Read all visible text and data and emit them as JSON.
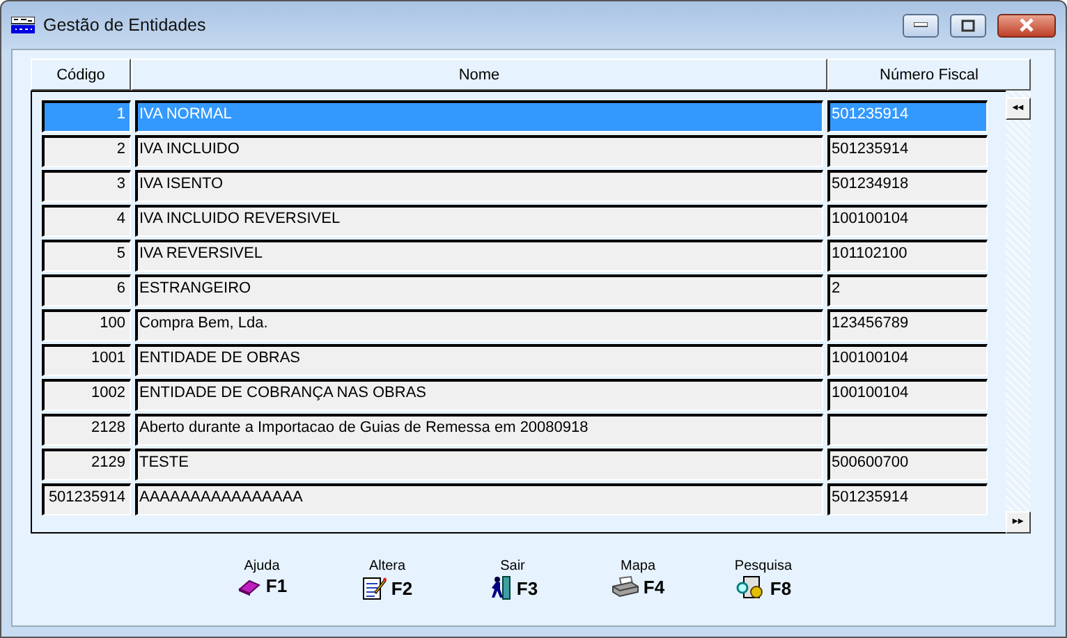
{
  "window": {
    "title": "Gestão de Entidades"
  },
  "table": {
    "columns": [
      "Código",
      "Nome",
      "Número Fiscal"
    ],
    "rows": [
      {
        "code": "1",
        "name": "IVA NORMAL",
        "fiscal": "501235914",
        "selected": true
      },
      {
        "code": "2",
        "name": "IVA INCLUIDO",
        "fiscal": "501235914",
        "selected": false
      },
      {
        "code": "3",
        "name": "IVA ISENTO",
        "fiscal": "501234918",
        "selected": false
      },
      {
        "code": "4",
        "name": "IVA INCLUIDO REVERSIVEL",
        "fiscal": "100100104",
        "selected": false
      },
      {
        "code": "5",
        "name": "IVA REVERSIVEL",
        "fiscal": "101102100",
        "selected": false
      },
      {
        "code": "6",
        "name": "ESTRANGEIRO",
        "fiscal": "2",
        "selected": false
      },
      {
        "code": "100",
        "name": "Compra Bem, Lda.",
        "fiscal": "123456789",
        "selected": false
      },
      {
        "code": "1001",
        "name": "ENTIDADE DE OBRAS",
        "fiscal": "100100104",
        "selected": false
      },
      {
        "code": "1002",
        "name": "ENTIDADE DE COBRANÇA NAS OBRAS",
        "fiscal": "100100104",
        "selected": false
      },
      {
        "code": "2128",
        "name": "Aberto durante a Importacao de Guias de Remessa em 20080918",
        "fiscal": "",
        "selected": false
      },
      {
        "code": "2129",
        "name": "TESTE",
        "fiscal": "500600700",
        "selected": false
      },
      {
        "code": "501235914",
        "name": "AAAAAAAAAAAAAAAA",
        "fiscal": "501235914",
        "selected": false
      }
    ]
  },
  "scroll_buttons": [
    "◂◂",
    "▸▸"
  ],
  "function_keys": [
    {
      "kind": "help",
      "label": "Ajuda",
      "key": "F1"
    },
    {
      "kind": "edit",
      "label": "Altera",
      "key": "F2"
    },
    {
      "kind": "exit",
      "label": "Sair",
      "key": "F3"
    },
    {
      "kind": "print",
      "label": "Mapa",
      "key": "F4"
    },
    {
      "kind": "search",
      "label": "Pesquisa",
      "key": "F8"
    }
  ]
}
